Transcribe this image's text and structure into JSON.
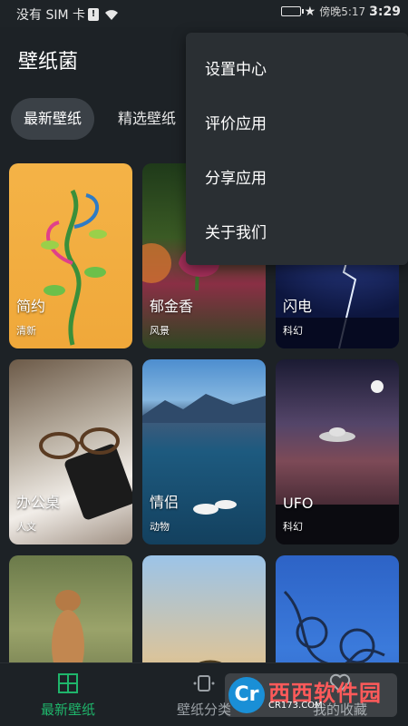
{
  "status_bar": {
    "carrier": "没有 SIM 卡",
    "time": "3:29",
    "time_prefix": "傍晚5:17"
  },
  "app": {
    "title": "壁纸菌"
  },
  "tabs": [
    {
      "label": "最新壁纸",
      "active": true
    },
    {
      "label": "精选壁纸",
      "active": false
    }
  ],
  "wallpapers": [
    {
      "title": "简约",
      "tag": "清新",
      "icon": "swirl-plant"
    },
    {
      "title": "郁金香",
      "tag": "风景",
      "icon": "tulip"
    },
    {
      "title": "闪电",
      "tag": "科幻",
      "icon": "lightning"
    },
    {
      "title": "办公桌",
      "tag": "人文",
      "icon": "glasses-phone"
    },
    {
      "title": "情侣",
      "tag": "动物",
      "icon": "swans-lake"
    },
    {
      "title": "UFO",
      "tag": "科幻",
      "icon": "ufo"
    },
    {
      "title": "",
      "tag": "",
      "icon": "meerkat"
    },
    {
      "title": "",
      "tag": "",
      "icon": "wheat"
    },
    {
      "title": "",
      "tag": "",
      "icon": "barbed-wire"
    }
  ],
  "menu": {
    "items": [
      "设置中心",
      "评价应用",
      "分享应用",
      "关于我们"
    ]
  },
  "bottom_nav": {
    "items": [
      {
        "label": "最新壁纸",
        "icon": "grid-icon",
        "active": true
      },
      {
        "label": "壁纸分类",
        "icon": "category-icon",
        "active": false
      },
      {
        "label": "我的收藏",
        "icon": "heart-icon",
        "active": false
      }
    ]
  },
  "watermark": {
    "brand": "西西软件园",
    "url": "CR173.COM",
    "logo": "Cr"
  },
  "colors": {
    "accent": "#1fb56b",
    "background": "#1d2226",
    "menu_bg": "#2a2f33"
  }
}
